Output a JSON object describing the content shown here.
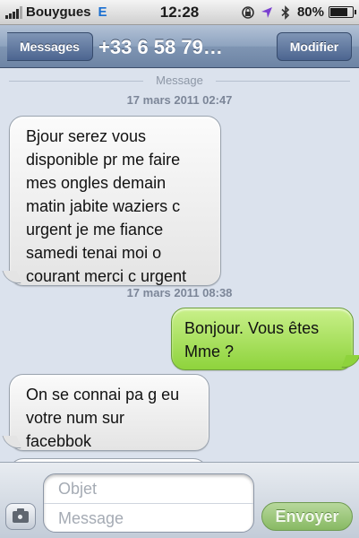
{
  "status_bar": {
    "carrier": "Bouygues",
    "network": "E",
    "time": "12:28",
    "battery": "80%",
    "battery_level": 0.8
  },
  "nav": {
    "back_label": "Messages",
    "title": "+33 6 58 79…",
    "edit_label": "Modifier"
  },
  "thread": {
    "separator_label": "Message",
    "messages": [
      {
        "timestamp": "17 mars 2011 02:47",
        "direction": "incoming",
        "lines": [
          "Bjour serez vous",
          "disponible pr me faire",
          "mes ongles demain",
          "matin jabite waziers c",
          "urgent je me fiance",
          "samedi tenai moi o",
          "courant merci c urgent"
        ]
      },
      {
        "timestamp": "17 mars 2011 08:38",
        "direction": "outgoing",
        "lines": [
          "Bonjour. Vous êtes",
          "Mme ?"
        ]
      },
      {
        "timestamp": "",
        "direction": "incoming",
        "lines": [
          "On se connai pa g eu",
          "votre num sur",
          "facebbok"
        ]
      }
    ]
  },
  "compose": {
    "subject_placeholder": "Objet",
    "message_placeholder": "Message",
    "send_label": "Envoyer"
  },
  "icons": {
    "signal": "signal-bars-icon",
    "lock_rotation": "rotation-lock-icon",
    "location": "location-arrow-icon",
    "bluetooth": "bluetooth-icon",
    "battery": "battery-icon",
    "camera": "camera-icon"
  },
  "colors": {
    "incoming_bubble": "#e4e4e4",
    "outgoing_bubble": "#8ed33c",
    "nav_bar": "#6d84a4",
    "thread_background": "#dbe2ed"
  }
}
